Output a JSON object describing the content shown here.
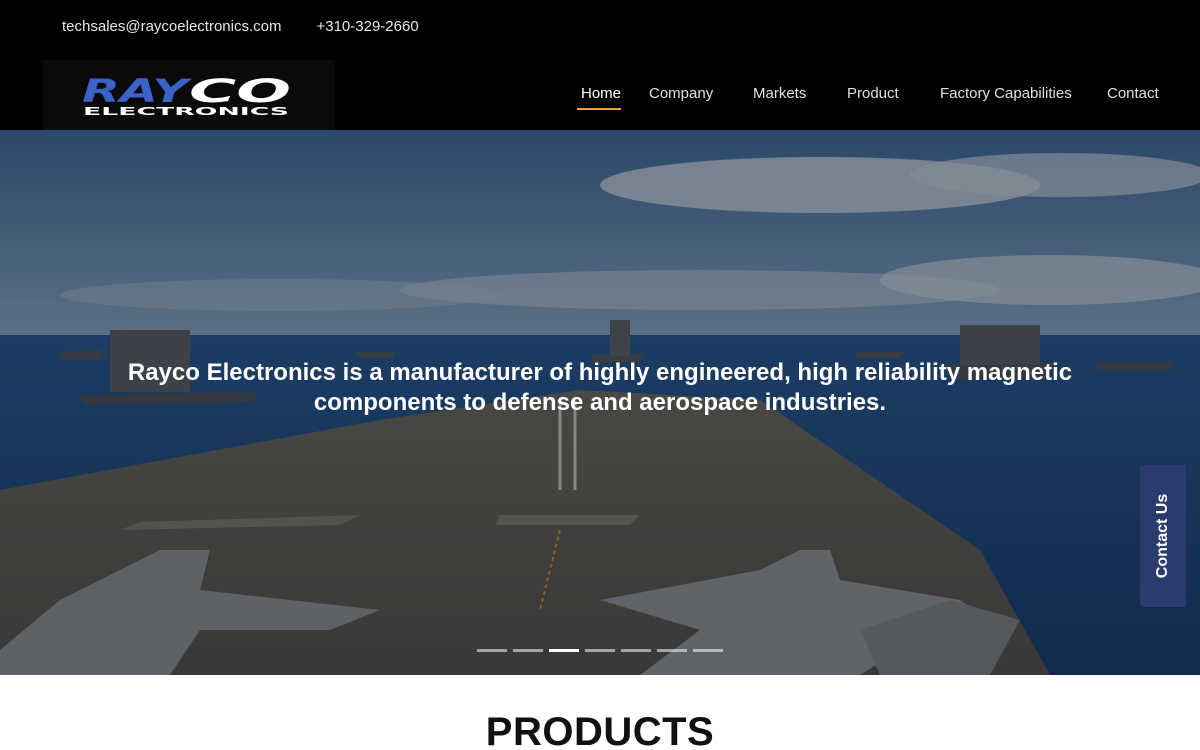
{
  "header": {
    "email": "techsales@raycoelectronics.com",
    "phone": "+310-329-2660",
    "logo": {
      "main_text": "RAYCO",
      "sub_text": "ELECTRONICS",
      "brand_blue": "#3a62c8"
    }
  },
  "nav": {
    "items": [
      {
        "label": "Home",
        "active": true
      },
      {
        "label": "Company"
      },
      {
        "label": "Markets"
      },
      {
        "label": "Product"
      },
      {
        "label": "Factory Capabilities"
      },
      {
        "label": "Contact"
      }
    ],
    "accent_color": "#f0a030"
  },
  "hero": {
    "headline": "Rayco Electronics is a manufacturer of highly engineered, high reliability magnetic components to defense and aerospace industries.",
    "slides_count": 7,
    "active_slide": 3
  },
  "contact_tab": {
    "label": "Contact Us"
  },
  "products": {
    "title": "PRODUCTS"
  }
}
